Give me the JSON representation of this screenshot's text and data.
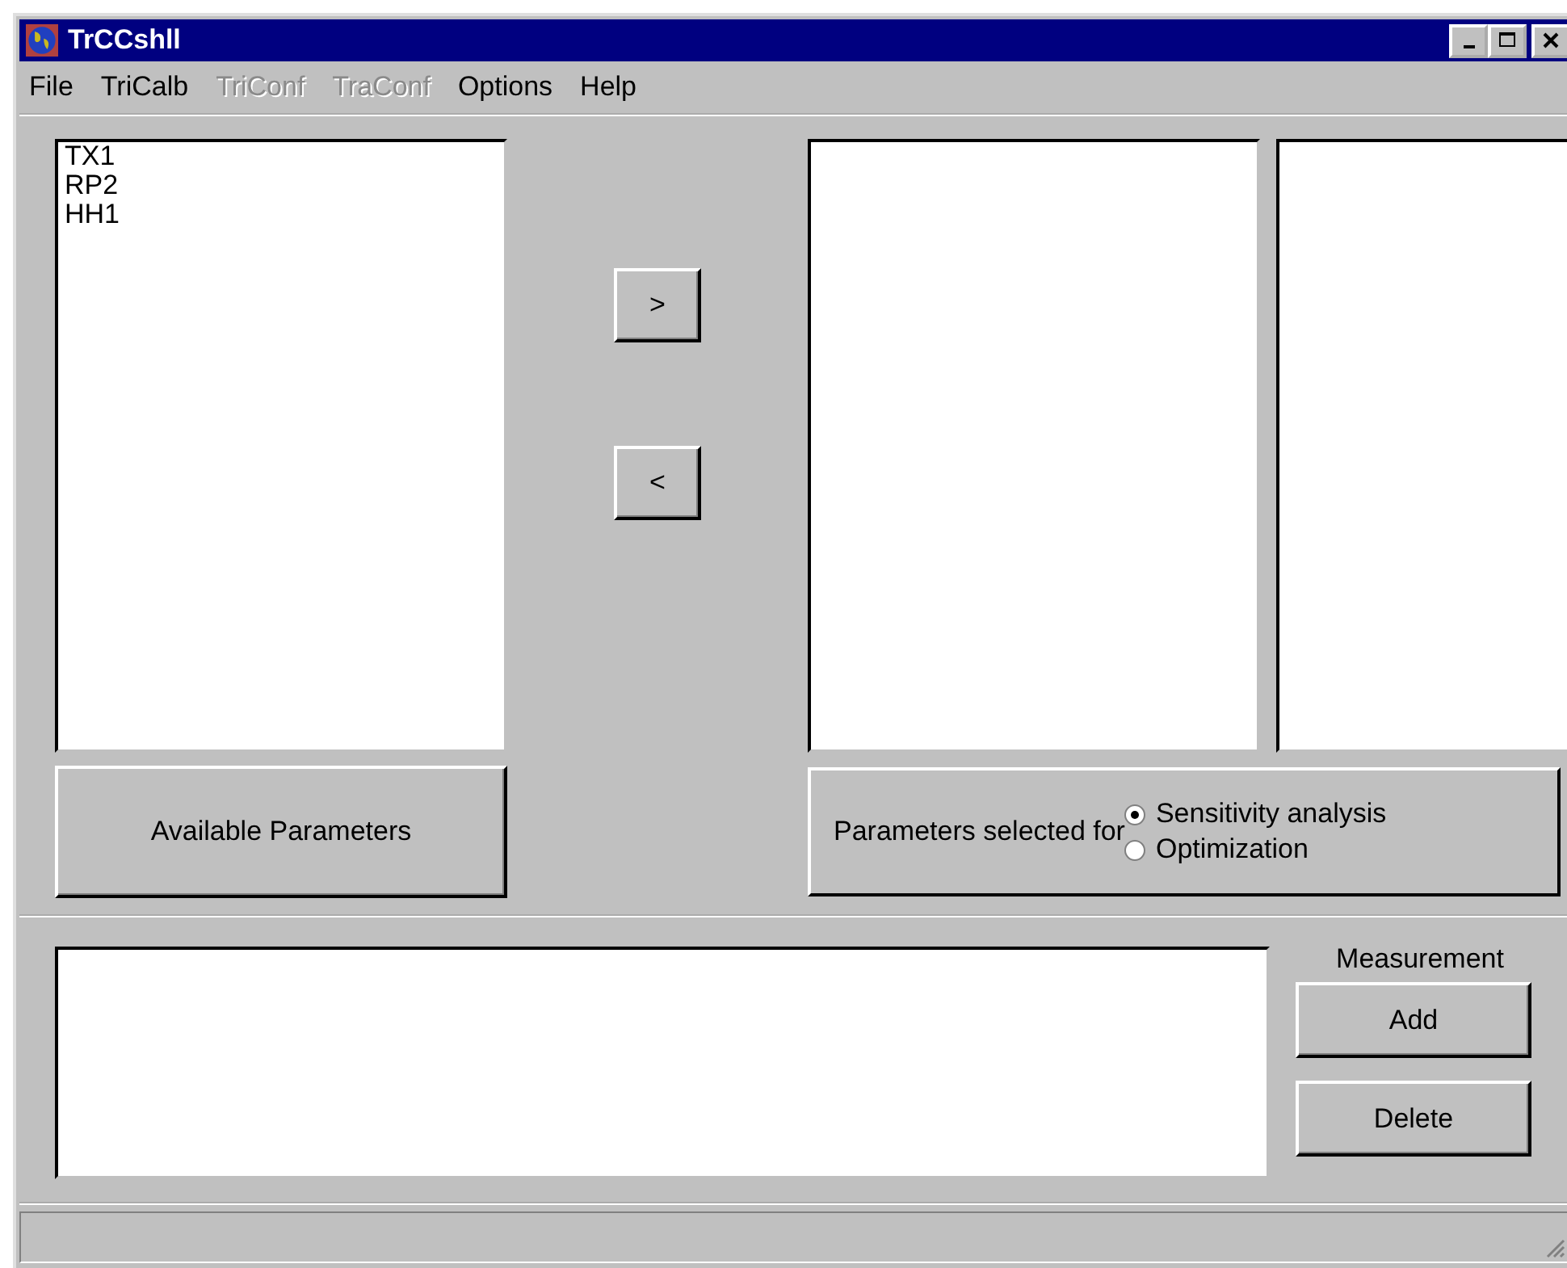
{
  "window": {
    "title": "TrCCshll"
  },
  "menu": [
    {
      "label": "File",
      "disabled": false
    },
    {
      "label": "TriCalb",
      "disabled": false
    },
    {
      "label": "TriConf",
      "disabled": true
    },
    {
      "label": "TraConf",
      "disabled": true
    },
    {
      "label": "Options",
      "disabled": false
    },
    {
      "label": "Help",
      "disabled": false
    }
  ],
  "available_list": {
    "items": [
      "TX1",
      "RP2",
      "HH1"
    ]
  },
  "move_buttons": [
    ">",
    "<"
  ],
  "available_button": "Available Parameters",
  "selection": {
    "label": "Parameters selected for",
    "options": [
      {
        "label": "Sensitivity analysis",
        "selected": true
      },
      {
        "label": "Optimization",
        "selected": false
      }
    ]
  },
  "measurement": {
    "label": "Measurement",
    "buttons": [
      "Add",
      "Delete"
    ]
  }
}
